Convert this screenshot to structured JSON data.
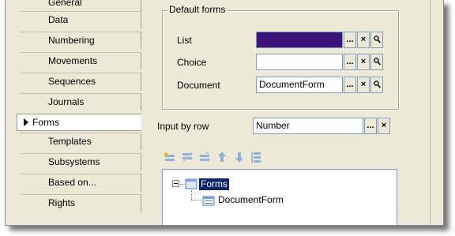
{
  "sidebar": {
    "items": [
      {
        "label": "General",
        "active": false
      },
      {
        "label": "Data",
        "active": false
      },
      {
        "label": "Numbering",
        "active": false
      },
      {
        "label": "Movements",
        "active": false
      },
      {
        "label": "Sequences",
        "active": false
      },
      {
        "label": "Journals",
        "active": false
      },
      {
        "label": "Forms",
        "active": true
      },
      {
        "label": "Templates",
        "active": false
      },
      {
        "label": "Subsystems",
        "active": false
      },
      {
        "label": "Based on...",
        "active": false
      },
      {
        "label": "Rights",
        "active": false
      }
    ]
  },
  "default_forms": {
    "title": "Default forms",
    "list_label": "List",
    "list_value": "",
    "choice_label": "Choice",
    "choice_value": "",
    "document_label": "Document",
    "document_value": "DocumentForm"
  },
  "input_by_row": {
    "label": "Input by row",
    "value": "Number"
  },
  "buttons": {
    "ellipsis": "...",
    "clear": "×"
  },
  "toolbar": {
    "icons": [
      "add-icon",
      "copy-icon",
      "edit-icon",
      "move-up-icon",
      "move-down-icon",
      "sort-icon"
    ]
  },
  "tree": {
    "root_label": "Forms",
    "child_label": "DocumentForm"
  },
  "colors": {
    "background": "#ece9d8",
    "selected_field": "#3b1277",
    "selection": "#0a246a",
    "border": "#7f9db9"
  }
}
